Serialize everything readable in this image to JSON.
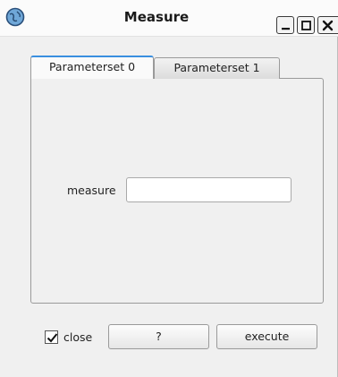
{
  "window": {
    "title": "Measure",
    "icon": "globe-icon"
  },
  "tabs": [
    {
      "label": "Parameterset 0",
      "active": true
    },
    {
      "label": "Parameterset 1",
      "active": false
    }
  ],
  "form": {
    "measure_label": "measure",
    "measure_value": ""
  },
  "footer": {
    "close_label": "close",
    "close_checked": true,
    "help_label": "?",
    "execute_label": "execute"
  },
  "colors": {
    "active_tab_accent": "#3a8fe0",
    "background": "#f0f0f0"
  }
}
